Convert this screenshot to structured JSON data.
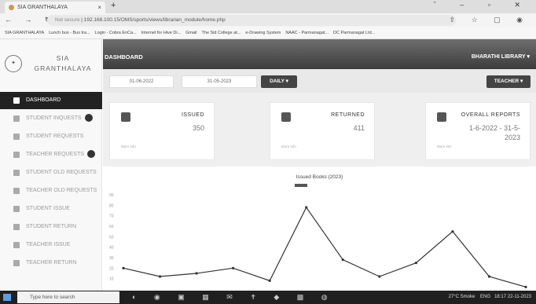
{
  "browser": {
    "tab_title": "SIA GRANTHALAYA",
    "new_tab": "+",
    "window_controls": "ˇ – ▫ ✕",
    "nav": "← → ↻",
    "security": "Not secure",
    "url": "192.168.100.15/OMS/sports/views/librarian_module/home.php",
    "addr_icons": "⇪ ☆ ▢ ◉",
    "bookmarks": [
      "SIA GRANTHALAYA",
      "Lunch bus - Bus tra...",
      "Login - Cobra EnCa...",
      "Internet for Hive Di...",
      "Gmail",
      "The Sid College at...",
      "e-Drawing System",
      "NAAC - Parmanagat...",
      "DC Parmanagat Ltd..."
    ]
  },
  "sidebar": {
    "brand_line1": "SIA",
    "brand_line2": "GRANTHALAYA",
    "seal_text": "✦",
    "items": [
      {
        "label": "DASHBOARD",
        "active": true
      },
      {
        "label": "STUDENT INQUESTS",
        "badge": true
      },
      {
        "label": "STUDENT REQUESTS"
      },
      {
        "label": "TEACHER REQUESTS",
        "badge": true
      },
      {
        "label": "STUDENT OLD REQUESTS"
      },
      {
        "label": "TEACHER OLD REQUESTS"
      },
      {
        "label": "STUDENT ISSUE"
      },
      {
        "label": "STUDENT RETURN"
      },
      {
        "label": "TEACHER ISSUE"
      },
      {
        "label": "TEACHER RETURN"
      }
    ]
  },
  "header": {
    "title": "DASHBOARD",
    "user": "BHARATHI LIBRARY ▾"
  },
  "filters": {
    "from_date": "01-06-2022",
    "to_date": "31-05-2023",
    "period": "DAILY ▾",
    "role": "TEACHER ▾"
  },
  "cards": [
    {
      "label": "ISSUED",
      "value": "350",
      "sub": "More info"
    },
    {
      "label": "RETURNED",
      "value": "411",
      "sub": "More info"
    },
    {
      "label": "OVERALL REPORTS",
      "value": "1-6-2022 - 31-5-2023",
      "sub": "More info"
    }
  ],
  "chart_data": {
    "type": "line",
    "title": "Issued Books (2023)",
    "x": [
      1,
      2,
      3,
      4,
      5,
      6,
      7,
      8,
      9,
      10,
      11,
      12
    ],
    "values": [
      20,
      12,
      15,
      20,
      8,
      78,
      28,
      12,
      25,
      55,
      12,
      2
    ],
    "ylim": [
      0,
      90
    ],
    "yticks": [
      10,
      20,
      30,
      40,
      50,
      60,
      70,
      80,
      90
    ],
    "ytick_labels": [
      "10",
      "20",
      "30",
      "40",
      "50",
      "60",
      "70",
      "80",
      "90"
    ],
    "grid": false,
    "legend": "top-center",
    "color": "#333333"
  },
  "taskbar": {
    "search_placeholder": "Type here to search",
    "weather": "27°C Smoke",
    "lang": "ENG",
    "time": "18:17",
    "date": "22-11-2023"
  }
}
